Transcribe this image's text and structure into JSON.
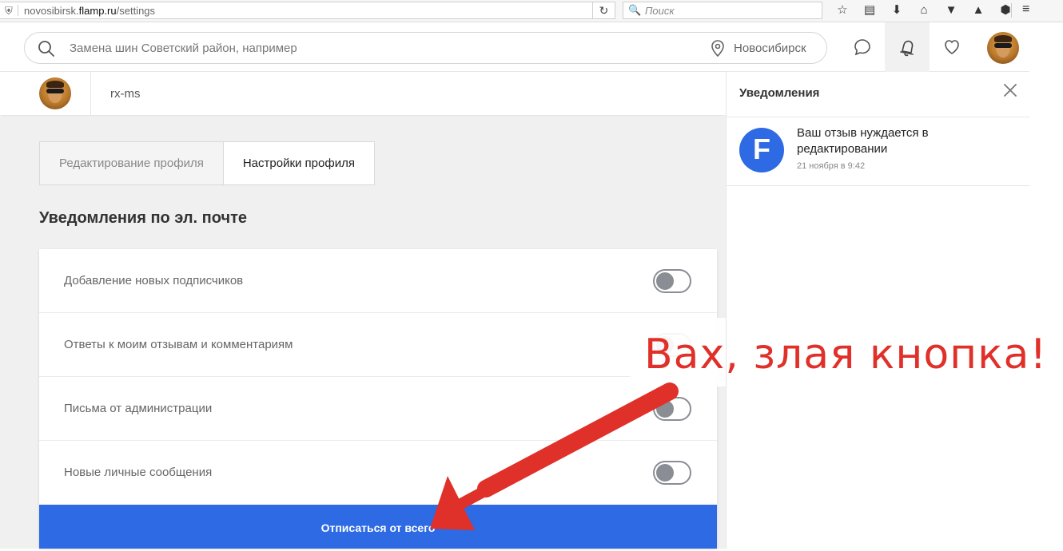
{
  "browser": {
    "url_prefix": "novosibirsk.",
    "url_domain": "flamp.ru",
    "url_path": "/settings",
    "search_placeholder": "Поиск"
  },
  "header": {
    "search_placeholder": "Замена шин Советский район, например",
    "city": "Новосибирск"
  },
  "profile": {
    "username": "rx-ms"
  },
  "tabs": [
    {
      "label": "Редактирование профиля"
    },
    {
      "label": "Настройки профиля"
    }
  ],
  "email_section": {
    "title": "Уведомления по эл. почте",
    "rows": [
      {
        "label": "Добавление новых подписчиков"
      },
      {
        "label": "Ответы к моим отзывам и комментариям"
      },
      {
        "label": "Письма от администрации"
      },
      {
        "label": "Новые личные сообщения"
      }
    ],
    "unsubscribe_label": "Отписаться от всего"
  },
  "notifications": {
    "title": "Уведомления",
    "items": [
      {
        "text": "Ваш отзыв нуждается в редактировании",
        "time": "21 ноября в 9:42",
        "logo": "F"
      }
    ]
  },
  "annotation": {
    "text": "Вах, злая кнопка!",
    "color": "#e0302a"
  },
  "colors": {
    "accent": "#2d6ae3",
    "toggle_off": "#8a8d93"
  },
  "icons": [
    "shield-icon",
    "reload-icon",
    "search-icon",
    "location-pin-icon",
    "chat-icon",
    "bell-icon",
    "heart-icon",
    "close-icon"
  ]
}
